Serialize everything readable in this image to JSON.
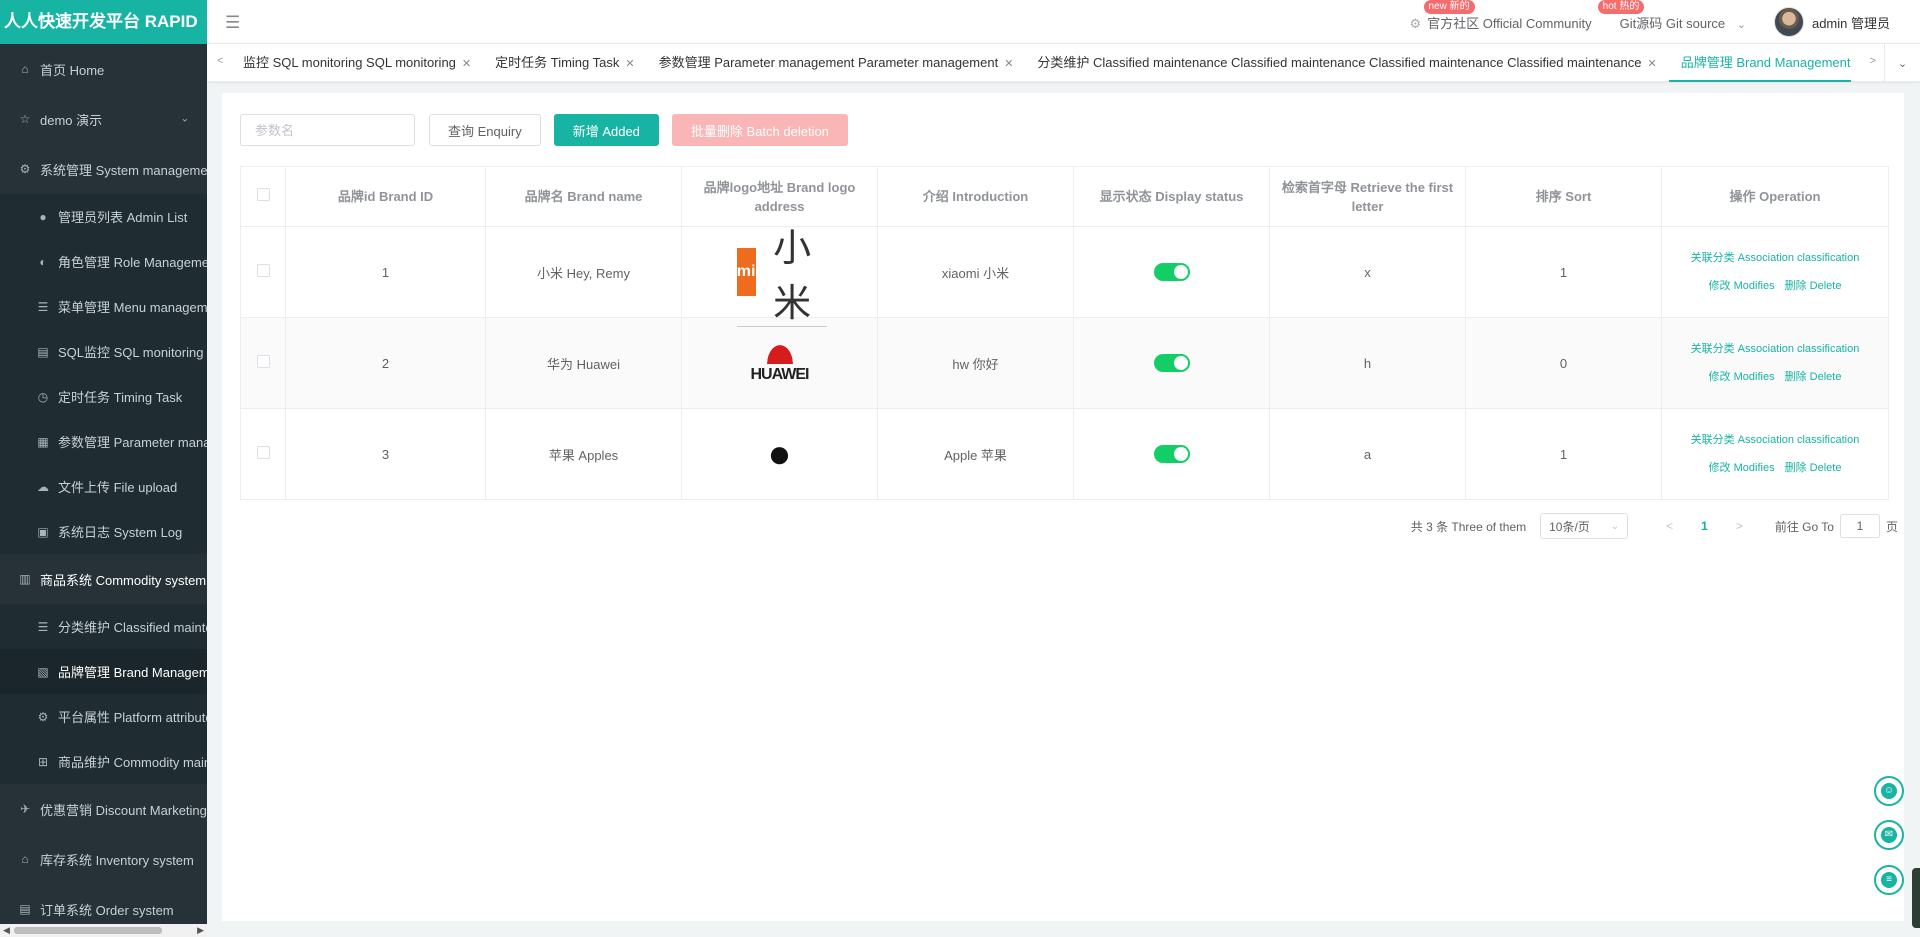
{
  "sidebar": {
    "brand": "人人快速开发平台 RAPID",
    "items": [
      {
        "label": "首页 Home",
        "icon": "home-icon",
        "glyph": "⌂",
        "type": "top"
      },
      {
        "label": "demo 演示",
        "icon": "star-icon",
        "glyph": "☆",
        "type": "top",
        "chevron": "⌄"
      },
      {
        "label": "系统管理 System management",
        "icon": "gear-icon",
        "glyph": "⚙",
        "type": "top"
      },
      {
        "label": "管理员列表 Admin List",
        "icon": "user-icon",
        "glyph": "●",
        "type": "sub"
      },
      {
        "label": "角色管理 Role Management",
        "icon": "role-icon",
        "glyph": "◐",
        "type": "sub"
      },
      {
        "label": "菜单管理 Menu management",
        "icon": "list-icon",
        "glyph": "☰",
        "type": "sub"
      },
      {
        "label": "SQL监控 SQL monitoring",
        "icon": "sql-icon",
        "glyph": "▤",
        "type": "sub"
      },
      {
        "label": "定时任务 Timing Task",
        "icon": "clock-icon",
        "glyph": "◷",
        "type": "sub"
      },
      {
        "label": "参数管理 Parameter management",
        "icon": "param-icon",
        "glyph": "▦",
        "type": "sub"
      },
      {
        "label": "文件上传 File upload",
        "icon": "cloud-icon",
        "glyph": "☁",
        "type": "sub"
      },
      {
        "label": "系统日志 System Log",
        "icon": "log-icon",
        "glyph": "▣",
        "type": "sub"
      },
      {
        "label": "商品系统 Commodity system",
        "icon": "commodity-icon",
        "glyph": "▥",
        "type": "top",
        "open": true
      },
      {
        "label": "分类维护 Classified maintenance",
        "icon": "list-icon",
        "glyph": "☰",
        "type": "sub"
      },
      {
        "label": "品牌管理 Brand Management",
        "icon": "brand-icon",
        "glyph": "▧",
        "type": "sub",
        "active": true
      },
      {
        "label": "平台属性 Platform attributes",
        "icon": "gear-icon",
        "glyph": "⚙",
        "type": "sub"
      },
      {
        "label": "商品维护 Commodity maintenance",
        "icon": "grid-icon",
        "glyph": "⊞",
        "type": "sub"
      },
      {
        "label": "优惠营销 Discount Marketing",
        "icon": "plane-icon",
        "glyph": "✈",
        "type": "top"
      },
      {
        "label": "库存系统 Inventory system",
        "icon": "home-icon",
        "glyph": "⌂",
        "type": "top"
      },
      {
        "label": "订单系统 Order system",
        "icon": "order-icon",
        "glyph": "▤",
        "type": "top"
      }
    ]
  },
  "header": {
    "hamburger": "☰",
    "community_badge": "new 新的",
    "community_label": "官方社区 Official Community",
    "git_badge": "hot 热的",
    "git_label": "Git源码 Git source",
    "git_chevron": "⌄",
    "user_name": "admin 管理员"
  },
  "tabs": [
    {
      "label": "监控 SQL monitoring SQL monitoring"
    },
    {
      "label": "定时任务 Timing Task"
    },
    {
      "label": "参数管理 Parameter management Parameter management"
    },
    {
      "label": "分类维护 Classified maintenance Classified maintenance Classified maintenance Classified maintenance"
    },
    {
      "label": "品牌管理 Brand Management",
      "active": true
    }
  ],
  "toolbar": {
    "search_placeholder": "参数名",
    "query_label": "查询 Enquiry",
    "add_label": "新增 Added",
    "batch_delete_label": "批量删除 Batch deletion"
  },
  "table": {
    "headers": [
      "品牌id Brand ID",
      "品牌名 Brand name",
      "品牌logo地址 Brand logo address",
      "介绍 Introduction",
      "显示状态 Display status",
      "检索首字母 Retrieve the first letter",
      "排序 Sort",
      "操作 Operation"
    ],
    "rows": [
      {
        "id": "1",
        "name": "小米 Hey, Remy",
        "logo": "xiaomi",
        "intro": "xiaomi 小米",
        "status_on": true,
        "letter": "x",
        "sort": "1"
      },
      {
        "id": "2",
        "name": "华为 Huawei",
        "logo": "huawei",
        "intro": "hw 你好",
        "status_on": true,
        "letter": "h",
        "sort": "0"
      },
      {
        "id": "3",
        "name": "苹果 Apples",
        "logo": "apple",
        "intro": "Apple 苹果",
        "status_on": true,
        "letter": "a",
        "sort": "1"
      }
    ],
    "op_assoc": "关联分类 Association classification",
    "op_modify": "修改 Modifies",
    "op_delete": "删除 Delete",
    "logo_text": {
      "xiaomi_mark": "mi",
      "xiaomi_word": "小米",
      "huawei_word": "HUAWEI",
      "apple_glyph": ""
    }
  },
  "pagination": {
    "total": "共 3 条 Three of them",
    "page_size": "10条/页",
    "current": "1",
    "goto_prefix": "前往 Go To",
    "goto_value": "1",
    "goto_suffix": "页"
  },
  "colors": {
    "accent": "#17b3a3",
    "sidebar_bg": "#263238",
    "switch_on": "#13ce66",
    "danger_light": "#fab6b6"
  }
}
